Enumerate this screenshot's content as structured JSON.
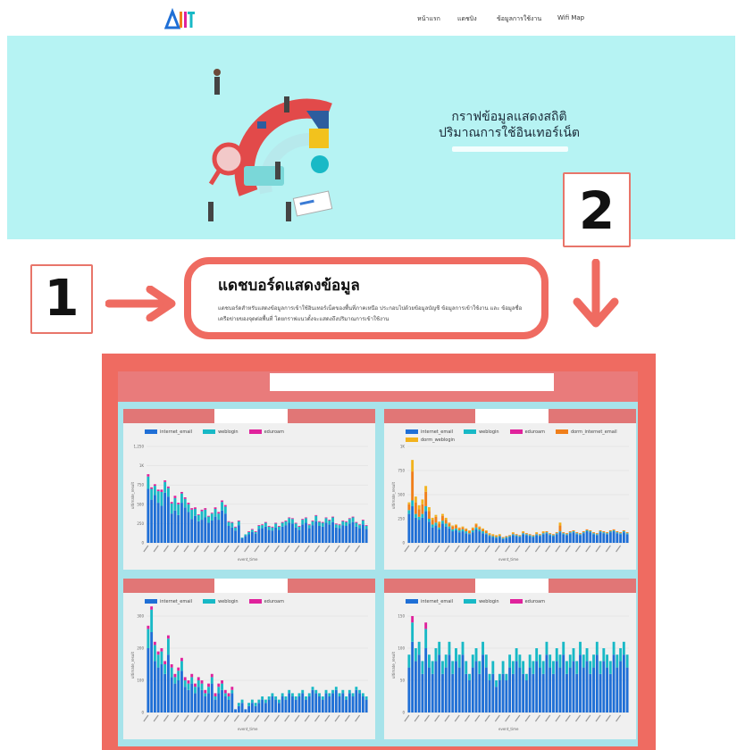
{
  "nav": {
    "logo_text": "ARIT",
    "items": [
      "หน้าแรก",
      "แดชบิง",
      "ข้อมูลการใช้งาน",
      "Wifi Map"
    ]
  },
  "hero": {
    "title_line1": "กราฟข้อมูลแสดงสถิติ",
    "title_line2": "ปริมาณการใช้อินเทอร์เน็ต"
  },
  "annotations": {
    "marker1": "1",
    "marker2": "2"
  },
  "section": {
    "title": "แดชบอร์ดแสดงข้อมูล",
    "description": "แดชบอร์ดสำหรับแสดงข้อมูลการเข้าใช้อินเทอร์เน็ตของพื้นที่ภาคเหนือ ประกอบไปด้วยข้อมูลบัญชี ข้อมูลการเข้าใช้งาน และ ข้อมูลชื่อเครือข่ายของจุดต่อพื้นที่ โดยกราฟแนวตั้งจะแสดงถึงปริมาณการเข้าใช้งาน"
  },
  "colors": {
    "accent": "#ef6b61",
    "hero_bg": "#b6f3f3",
    "internet_email": "#1f6fd6",
    "weblogin": "#18b9c6",
    "eduroam": "#e0229c",
    "dorm_internet_email": "#f07f1a",
    "dorm_weblogin": "#f2b21d"
  },
  "chart_data": [
    {
      "type": "bar",
      "legend": [
        "internet_email",
        "weblogin",
        "eduroam"
      ],
      "yticks": [
        "1,250",
        "1K",
        "750",
        "500",
        "250",
        "0"
      ],
      "xlabel": "event_time",
      "ylabel": "ultimate_result",
      "series": [
        {
          "name": "internet_email",
          "values": [
            700,
            560,
            620,
            520,
            480,
            650,
            600,
            380,
            420,
            360,
            520,
            460,
            400,
            310,
            350,
            280,
            300,
            330,
            260,
            290,
            340,
            300,
            420,
            380,
            220,
            200,
            160,
            230,
            60,
            90,
            110,
            140,
            120,
            180,
            190,
            210,
            170,
            160,
            200,
            170,
            210,
            230,
            260,
            250,
            200,
            170,
            240,
            260,
            190,
            230,
            280,
            220,
            210,
            260,
            240,
            270,
            200,
            190,
            230,
            220,
            250,
            270,
            210,
            190,
            240,
            180
          ]
        },
        {
          "name": "weblogin",
          "values": [
            160,
            140,
            120,
            150,
            180,
            140,
            110,
            130,
            160,
            140,
            120,
            110,
            100,
            120,
            90,
            80,
            110,
            100,
            80,
            90,
            100,
            80,
            110,
            90,
            50,
            60,
            40,
            50,
            10,
            20,
            30,
            30,
            20,
            40,
            40,
            50,
            40,
            40,
            50,
            40,
            50,
            50,
            60,
            60,
            50,
            40,
            60,
            60,
            40,
            50,
            70,
            50,
            50,
            60,
            50,
            60,
            40,
            40,
            50,
            50,
            60,
            60,
            50,
            40,
            50,
            40
          ]
        },
        {
          "name": "eduroam",
          "values": [
            30,
            20,
            20,
            20,
            30,
            20,
            20,
            20,
            30,
            20,
            20,
            20,
            20,
            20,
            20,
            10,
            20,
            20,
            10,
            10,
            20,
            20,
            20,
            20,
            10,
            10,
            10,
            10,
            0,
            0,
            10,
            10,
            10,
            10,
            10,
            10,
            10,
            10,
            10,
            10,
            10,
            10,
            10,
            10,
            10,
            10,
            10,
            10,
            10,
            10,
            10,
            10,
            10,
            10,
            10,
            10,
            10,
            10,
            10,
            10,
            10,
            10,
            10,
            10,
            10,
            10
          ]
        }
      ],
      "ylim": [
        0,
        1250
      ]
    },
    {
      "type": "bar",
      "legend": [
        "internet_email",
        "weblogin",
        "eduroam",
        "dorm_internet_email",
        "dorm_weblogin"
      ],
      "yticks": [
        "1K",
        "750",
        "500",
        "250",
        "0"
      ],
      "xlabel": "event_time",
      "ylabel": "ultimate_result",
      "series": [
        {
          "name": "internet_email",
          "values": [
            300,
            380,
            260,
            240,
            260,
            330,
            220,
            160,
            180,
            140,
            200,
            170,
            150,
            120,
            130,
            110,
            120,
            100,
            90,
            110,
            140,
            120,
            100,
            90,
            70,
            60,
            50,
            60,
            40,
            50,
            60,
            80,
            70,
            60,
            90,
            80,
            70,
            60,
            80,
            70,
            90,
            100,
            80,
            70,
            90,
            110,
            90,
            80,
            100,
            110,
            90,
            80,
            100,
            120,
            110,
            90,
            80,
            110,
            100,
            90,
            110,
            120,
            100,
            90,
            110,
            90
          ]
        },
        {
          "name": "weblogin",
          "values": [
            40,
            60,
            40,
            30,
            40,
            50,
            30,
            30,
            30,
            20,
            30,
            30,
            20,
            20,
            20,
            20,
            20,
            20,
            10,
            20,
            20,
            20,
            20,
            10,
            10,
            10,
            10,
            10,
            10,
            10,
            10,
            10,
            10,
            10,
            10,
            10,
            10,
            10,
            10,
            10,
            10,
            10,
            10,
            10,
            10,
            10,
            10,
            10,
            10,
            10,
            10,
            10,
            10,
            10,
            10,
            10,
            10,
            10,
            10,
            10,
            10,
            10,
            10,
            10,
            10,
            10
          ]
        },
        {
          "name": "dorm_internet_email",
          "values": [
            60,
            300,
            120,
            80,
            100,
            150,
            80,
            50,
            60,
            40,
            50,
            40,
            30,
            30,
            30,
            20,
            20,
            20,
            20,
            20,
            30,
            20,
            20,
            20,
            10,
            10,
            10,
            10,
            10,
            10,
            10,
            10,
            10,
            10,
            10,
            10,
            10,
            10,
            10,
            10,
            10,
            10,
            10,
            10,
            10,
            60,
            10,
            10,
            10,
            10,
            10,
            10,
            10,
            10,
            10,
            10,
            10,
            10,
            10,
            10,
            10,
            10,
            10,
            10,
            10,
            10
          ]
        },
        {
          "name": "dorm_weblogin",
          "values": [
            20,
            120,
            60,
            40,
            50,
            60,
            40,
            20,
            20,
            20,
            20,
            20,
            10,
            10,
            10,
            10,
            10,
            10,
            10,
            10,
            10,
            10,
            10,
            10,
            10,
            10,
            10,
            10,
            0,
            0,
            0,
            10,
            0,
            0,
            10,
            0,
            0,
            0,
            10,
            0,
            10,
            0,
            0,
            0,
            0,
            30,
            0,
            0,
            0,
            0,
            0,
            0,
            0,
            0,
            0,
            0,
            0,
            0,
            0,
            0,
            0,
            0,
            0,
            0,
            0,
            0
          ]
        }
      ],
      "ylim": [
        0,
        1000
      ]
    },
    {
      "type": "bar",
      "legend": [
        "internet_email",
        "weblogin",
        "eduroam"
      ],
      "yticks": [
        "300",
        "200",
        "100",
        "0"
      ],
      "xlabel": "event_time",
      "ylabel": "ultimate_result",
      "series": [
        {
          "name": "internet_email",
          "values": [
            200,
            250,
            160,
            140,
            150,
            120,
            180,
            110,
            90,
            100,
            130,
            80,
            70,
            90,
            60,
            80,
            70,
            50,
            60,
            90,
            40,
            60,
            70,
            50,
            40,
            60,
            10,
            20,
            30,
            10,
            20,
            30,
            20,
            30,
            40,
            30,
            40,
            50,
            40,
            30,
            50,
            40,
            60,
            50,
            40,
            50,
            60,
            40,
            50,
            70,
            60,
            50,
            40,
            60,
            50,
            60,
            70,
            50,
            60,
            40,
            60,
            50,
            70,
            60,
            50,
            40
          ]
        },
        {
          "name": "weblogin",
          "values": [
            60,
            70,
            50,
            40,
            40,
            30,
            50,
            30,
            20,
            30,
            30,
            20,
            20,
            20,
            20,
            20,
            20,
            10,
            20,
            20,
            10,
            20,
            20,
            10,
            10,
            10,
            0,
            10,
            10,
            0,
            10,
            10,
            10,
            10,
            10,
            10,
            10,
            10,
            10,
            10,
            10,
            10,
            10,
            10,
            10,
            10,
            10,
            10,
            10,
            10,
            10,
            10,
            10,
            10,
            10,
            10,
            10,
            10,
            10,
            10,
            10,
            10,
            10,
            10,
            10,
            10
          ]
        },
        {
          "name": "eduroam",
          "values": [
            10,
            10,
            10,
            10,
            10,
            10,
            10,
            10,
            10,
            10,
            10,
            10,
            10,
            10,
            10,
            10,
            10,
            10,
            10,
            10,
            10,
            10,
            10,
            10,
            10,
            10,
            0,
            0,
            0,
            0,
            0,
            0,
            0,
            0,
            0,
            0,
            0,
            0,
            0,
            0,
            0,
            0,
            0,
            0,
            0,
            0,
            0,
            0,
            0,
            0,
            0,
            0,
            0,
            0,
            0,
            0,
            0,
            0,
            0,
            0,
            0,
            0,
            0,
            0,
            0,
            0
          ]
        }
      ],
      "ylim": [
        0,
        300
      ]
    },
    {
      "type": "bar",
      "legend": [
        "internet_email",
        "weblogin",
        "eduroam"
      ],
      "yticks": [
        "150",
        "100",
        "50",
        "0"
      ],
      "xlabel": "event_time",
      "ylabel": "ultimate_result",
      "series": [
        {
          "name": "internet_email",
          "values": [
            70,
            110,
            80,
            90,
            60,
            100,
            70,
            60,
            80,
            90,
            60,
            70,
            90,
            60,
            80,
            70,
            90,
            60,
            50,
            70,
            80,
            60,
            90,
            70,
            50,
            60,
            40,
            50,
            60,
            50,
            70,
            60,
            80,
            70,
            60,
            50,
            70,
            60,
            80,
            70,
            60,
            90,
            70,
            60,
            80,
            70,
            90,
            60,
            70,
            80,
            60,
            90,
            70,
            80,
            60,
            70,
            90,
            60,
            80,
            70,
            60,
            90,
            70,
            80,
            90,
            70
          ]
        },
        {
          "name": "weblogin",
          "values": [
            20,
            30,
            20,
            20,
            20,
            30,
            20,
            20,
            20,
            20,
            20,
            20,
            20,
            20,
            20,
            20,
            20,
            20,
            10,
            20,
            20,
            20,
            20,
            20,
            10,
            20,
            10,
            10,
            20,
            10,
            20,
            20,
            20,
            20,
            20,
            10,
            20,
            20,
            20,
            20,
            20,
            20,
            20,
            20,
            20,
            20,
            20,
            20,
            20,
            20,
            20,
            20,
            20,
            20,
            20,
            20,
            20,
            20,
            20,
            20,
            20,
            20,
            20,
            20,
            20,
            20
          ]
        },
        {
          "name": "eduroam",
          "values": [
            0,
            10,
            0,
            0,
            0,
            10,
            0,
            0,
            0,
            0,
            0,
            0,
            0,
            0,
            0,
            0,
            0,
            0,
            0,
            0,
            0,
            0,
            0,
            0,
            0,
            0,
            0,
            0,
            0,
            0,
            0,
            0,
            0,
            0,
            0,
            0,
            0,
            0,
            0,
            0,
            0,
            0,
            0,
            0,
            0,
            0,
            0,
            0,
            0,
            0,
            0,
            0,
            0,
            0,
            0,
            0,
            0,
            0,
            0,
            0,
            0,
            0,
            0,
            0,
            0,
            0
          ]
        }
      ],
      "ylim": [
        0,
        150
      ]
    }
  ]
}
